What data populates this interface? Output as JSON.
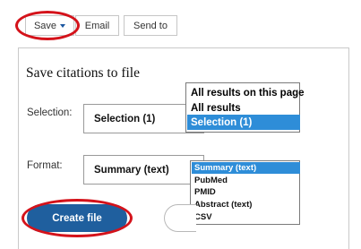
{
  "toolbar": {
    "save_label": "Save",
    "email_label": "Email",
    "send_to_label": "Send to"
  },
  "panel": {
    "title": "Save citations to file",
    "selection_label": "Selection:",
    "selection_value": "Selection (1)",
    "format_label": "Format:",
    "format_value": "Summary (text)",
    "create_label": "Create file"
  },
  "selection_dropdown": {
    "options": [
      "All results on this page",
      "All results",
      "Selection (1)"
    ],
    "highlighted": "Selection (1)"
  },
  "format_dropdown": {
    "options": [
      "Summary (text)",
      "PubMed",
      "PMID",
      "Abstract (text)",
      "CSV"
    ],
    "highlighted": "Summary (text)"
  },
  "colors": {
    "accent": "#1f5f9e",
    "highlight": "#2e8dd8",
    "annotation_circle": "#d4121a"
  }
}
